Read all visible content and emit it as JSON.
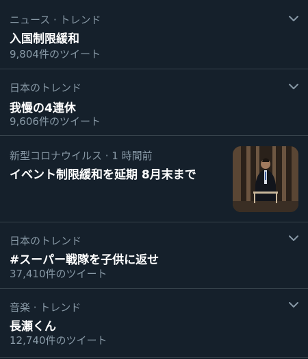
{
  "trends": [
    {
      "meta": "ニュース · トレンド",
      "title": "入国制限緩和",
      "count": "9,804件のツイート"
    },
    {
      "meta": "日本のトレンド",
      "title": "我慢の4連休",
      "count": "9,606件のツイート"
    },
    {
      "meta": "新型コロナウイルス · 1 時間前",
      "title": "イベント制限緩和を延期 8月末まで"
    },
    {
      "meta": "日本のトレンド",
      "title": "#スーパー戦隊を子供に返せ",
      "count": "37,410件のツイート"
    },
    {
      "meta": "音楽 · トレンド",
      "title": "長瀬くん",
      "count": "12,740件のツイート"
    }
  ],
  "icons": {
    "more": "chevron-down-icon",
    "news_image": "news-thumbnail"
  },
  "colors": {
    "background": "#15202b",
    "secondary_text": "#8899a6",
    "divider": "#38444d"
  }
}
